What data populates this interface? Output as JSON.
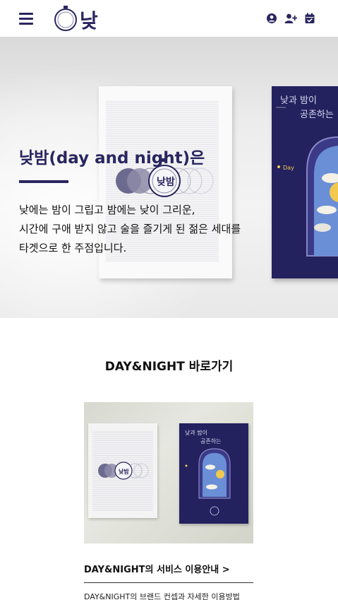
{
  "header": {
    "logo_text": "낮밤",
    "menu_icon": "hamburger-icon",
    "icons": [
      "user-circle-icon",
      "user-plus-icon",
      "calendar-check-icon"
    ]
  },
  "hero": {
    "title": "낮밤(day and night)은",
    "desc_lines": [
      "낮에는 밤이 그립고 밤에는 낮이 그리운,",
      "시간에 구애 받지 않고 술을 즐기게 된 젊은 세대를",
      "타겟으로 한 주점입니다."
    ],
    "poster_lines": [
      "낮과 밤이",
      "공존하는"
    ],
    "poster_day_label": "Day"
  },
  "section": {
    "title": "DAY&NIGHT 바로가기"
  },
  "card": {
    "title": "DAY&NIGHT의 서비스 이용안내 >",
    "desc": "DAY&NIGHT의 브랜드 컨셉과 자세한 이용방법"
  },
  "colors": {
    "brand_navy": "#2a2660",
    "poster_navy": "#23215e"
  }
}
